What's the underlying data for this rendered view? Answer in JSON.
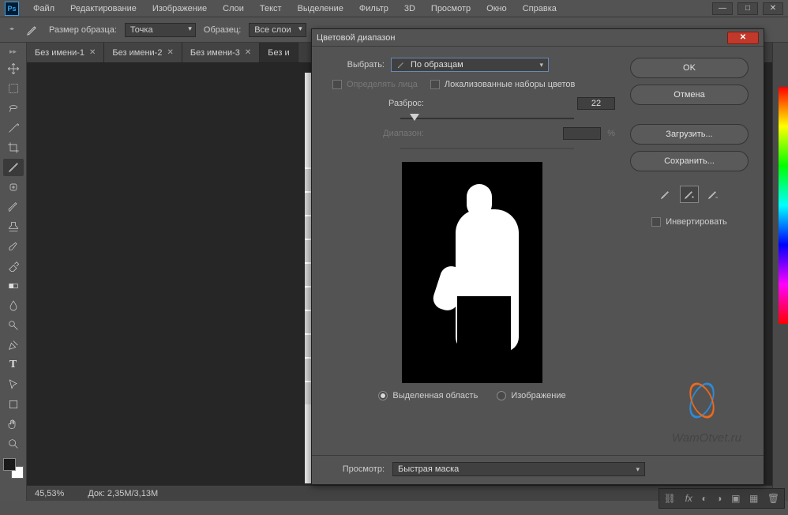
{
  "menu": {
    "items": [
      "Файл",
      "Редактирование",
      "Изображение",
      "Слои",
      "Текст",
      "Выделение",
      "Фильтр",
      "3D",
      "Просмотр",
      "Окно",
      "Справка"
    ]
  },
  "options_bar": {
    "sample_size_label": "Размер образца:",
    "sample_size_value": "Точка",
    "sample_label": "Образец:",
    "sample_value": "Все слои"
  },
  "tabs": [
    {
      "label": "Без имени-1"
    },
    {
      "label": "Без имени-2"
    },
    {
      "label": "Без имени-3"
    },
    {
      "label": "Без и"
    }
  ],
  "statusbar": {
    "zoom": "45,53%",
    "doc": "Док: 2,35M/3,13M"
  },
  "dialog": {
    "title": "Цветовой диапазон",
    "select_label": "Выбрать:",
    "select_value": "По образцам",
    "detect_faces_label": "Определять лица",
    "localized_label": "Локализованные наборы цветов",
    "fuzziness_label": "Разброс:",
    "fuzziness_value": "22",
    "range_label": "Диапазон:",
    "range_value": "",
    "range_unit": "%",
    "radio_selection": "Выделенная область",
    "radio_image": "Изображение",
    "preview_label": "Просмотр:",
    "preview_value": "Быстрая маска",
    "buttons": {
      "ok": "OK",
      "cancel": "Отмена",
      "load": "Загрузить...",
      "save": "Сохранить..."
    },
    "invert_label": "Инвертировать"
  },
  "watermark": "WamOtvet.ru"
}
